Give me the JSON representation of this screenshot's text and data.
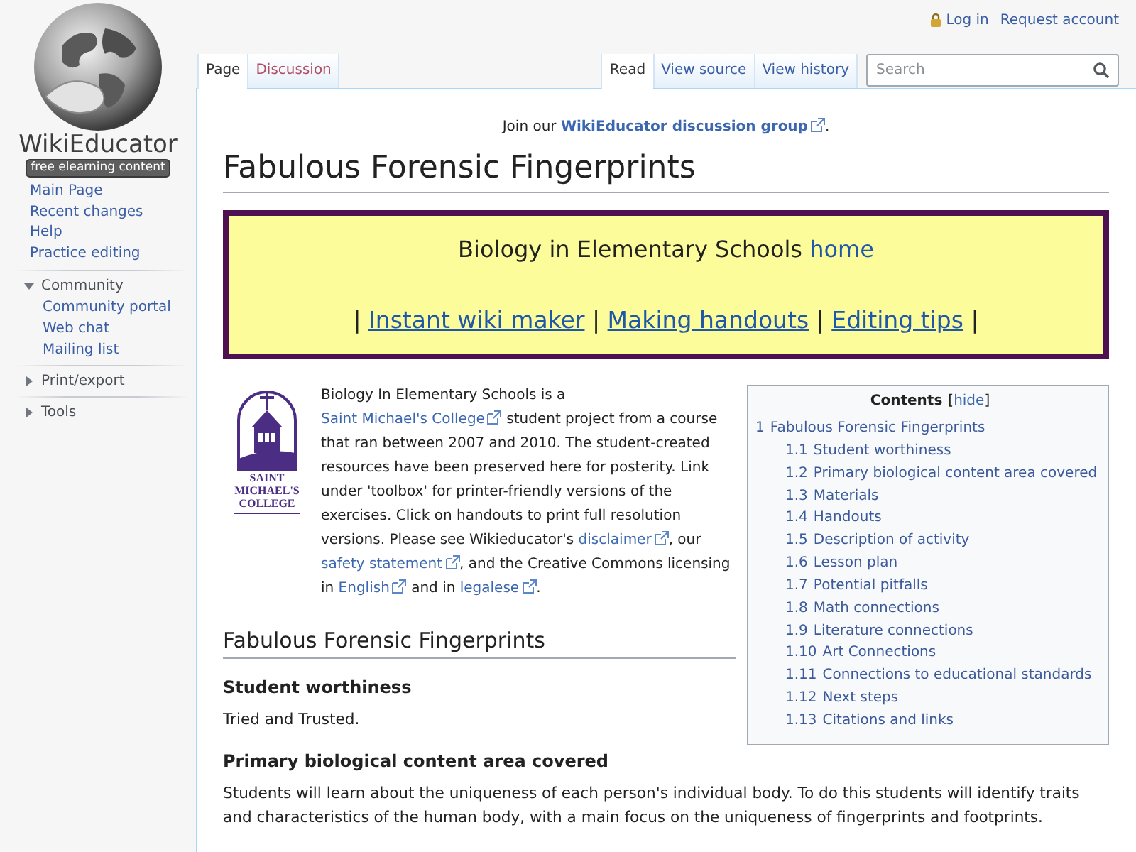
{
  "logo": {
    "title": "WikiEducator",
    "tagline": "free elearning content"
  },
  "personal_tools": [
    {
      "label": "Log in",
      "kind": "login"
    },
    {
      "label": "Request account",
      "kind": "link"
    }
  ],
  "namespace_tabs": [
    {
      "label": "Page",
      "selected": true,
      "kind": "link"
    },
    {
      "label": "Discussion",
      "selected": false,
      "kind": "new"
    }
  ],
  "view_tabs": [
    {
      "label": "Read",
      "selected": true,
      "kind": "link"
    },
    {
      "label": "View source",
      "selected": false,
      "kind": "link"
    },
    {
      "label": "View history",
      "selected": false,
      "kind": "link"
    }
  ],
  "search": {
    "placeholder": "Search"
  },
  "sidebar": {
    "navigation": [
      "Main Page",
      "Recent changes",
      "Help",
      "Practice editing"
    ],
    "portals": [
      {
        "label": "Community",
        "expanded": true,
        "items": [
          "Community portal",
          "Web chat",
          "Mailing list"
        ]
      },
      {
        "label": "Print/export",
        "expanded": false
      },
      {
        "label": "Tools",
        "expanded": false
      }
    ]
  },
  "site_notice": [
    {
      "kind": "text",
      "text": "Join our "
    },
    {
      "kind": "external",
      "text": "WikiEducator discussion group"
    },
    {
      "kind": "text",
      "text": "."
    }
  ],
  "title": "Fabulous Forensic Fingerprints",
  "banner": {
    "lines": [
      [
        {
          "kind": "text",
          "text": "Biology in Elementary Schools "
        },
        {
          "kind": "link",
          "text": "home"
        }
      ],
      [
        {
          "kind": "text",
          "text": "| "
        },
        {
          "kind": "underlined",
          "text": "Instant wiki maker"
        },
        {
          "kind": "text",
          "text": " | "
        },
        {
          "kind": "underlined",
          "text": "Making handouts"
        },
        {
          "kind": "text",
          "text": " | "
        },
        {
          "kind": "underlined",
          "text": "Editing tips"
        },
        {
          "kind": "text",
          "text": " |"
        }
      ]
    ]
  },
  "toc": {
    "title": "Contents",
    "toggle": [
      {
        "kind": "text",
        "text": "["
      },
      {
        "kind": "link",
        "text": "hide"
      },
      {
        "kind": "text",
        "text": "]"
      }
    ],
    "items": [
      {
        "number": "1",
        "label": "Fabulous Forensic Fingerprints",
        "children": [
          {
            "number": "1.1",
            "label": "Student worthiness"
          },
          {
            "number": "1.2",
            "label": "Primary biological content area covered"
          },
          {
            "number": "1.3",
            "label": "Materials"
          },
          {
            "number": "1.4",
            "label": "Handouts"
          },
          {
            "number": "1.5",
            "label": "Description of activity"
          },
          {
            "number": "1.6",
            "label": "Lesson plan"
          },
          {
            "number": "1.7",
            "label": "Potential pitfalls"
          },
          {
            "number": "1.8",
            "label": "Math connections"
          },
          {
            "number": "1.9",
            "label": "Literature connections"
          },
          {
            "number": "1.10",
            "label": "Art Connections"
          },
          {
            "number": "1.11",
            "label": "Connections to educational standards"
          },
          {
            "number": "1.12",
            "label": "Next steps"
          },
          {
            "number": "1.13",
            "label": "Citations and links"
          }
        ]
      }
    ]
  },
  "college_logo": {
    "lines": [
      "SAINT",
      "MICHAEL'S",
      "COLLEGE"
    ]
  },
  "intro": [
    {
      "kind": "text",
      "text": "Biology In Elementary Schools is a "
    },
    {
      "kind": "external",
      "text": "Saint Michael's College"
    },
    {
      "kind": "text",
      "text": " student project from a course that ran between 2007 and 2010. The student-created resources have been preserved here for posterity. Link under 'toolbox' for printer-friendly versions of the exercises. Click on handouts to print full resolution versions. Please see Wikieducator's "
    },
    {
      "kind": "external",
      "text": "disclaimer"
    },
    {
      "kind": "text",
      "text": ", our "
    },
    {
      "kind": "external",
      "text": "safety statement"
    },
    {
      "kind": "text",
      "text": ", and the Creative Commons licensing in "
    },
    {
      "kind": "external",
      "text": "English"
    },
    {
      "kind": "text",
      "text": " and in "
    },
    {
      "kind": "external",
      "text": "legalese"
    },
    {
      "kind": "text",
      "text": "."
    }
  ],
  "sections": [
    {
      "kind": "h2",
      "text": "Fabulous Forensic Fingerprints"
    },
    {
      "kind": "h3",
      "text": "Student worthiness"
    },
    {
      "kind": "p",
      "text": "Tried and Trusted."
    },
    {
      "kind": "h3",
      "text": "Primary biological content area covered"
    },
    {
      "kind": "p",
      "text": "Students will learn about the uniqueness of each person's individual body. To do this students will identify traits and characteristics of the human body, with a main focus on the uniqueness of fingerprints and footprints."
    }
  ]
}
